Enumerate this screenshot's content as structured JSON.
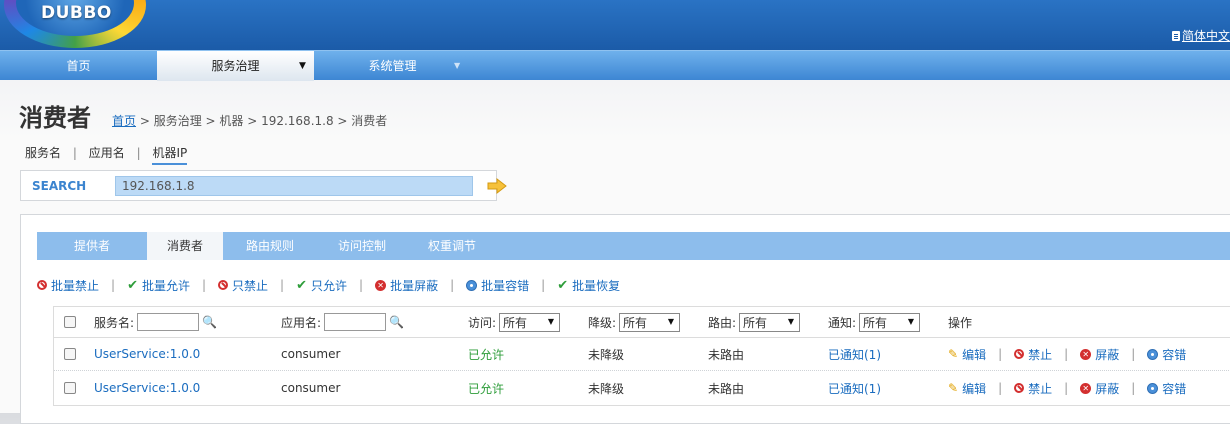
{
  "header": {
    "logo_text": "DUBBO",
    "language": "简体中文"
  },
  "nav": {
    "items": [
      {
        "label": "首页"
      },
      {
        "label": "服务治理"
      },
      {
        "label": "系统管理"
      }
    ]
  },
  "page": {
    "title": "消费者",
    "breadcrumb": {
      "home": "首页",
      "rest": " > 服务治理 > 机器 > 192.168.1.8 > 消费者"
    }
  },
  "filter_tabs": {
    "items": [
      "服务名",
      "应用名",
      "机器IP"
    ],
    "separator": "|",
    "active": "机器IP"
  },
  "search": {
    "label": "SEARCH",
    "value": "192.168.1.8"
  },
  "tabs": {
    "items": [
      "提供者",
      "消费者",
      "路由规则",
      "访问控制",
      "权重调节"
    ],
    "active": "消费者"
  },
  "toolbar": {
    "batch_disable": "批量禁止",
    "batch_allow": "批量允许",
    "only_disable": "只禁止",
    "only_allow": "只允许",
    "batch_shield": "批量屏蔽",
    "batch_tolerance": "批量容错",
    "batch_restore": "批量恢复",
    "separator": "|"
  },
  "table": {
    "headers": {
      "service": "服务名:",
      "app": "应用名:",
      "access": "访问:",
      "degrade": "降级:",
      "route": "路由:",
      "notify": "通知:",
      "ops": "操作"
    },
    "filter_option": "所有",
    "rows": [
      {
        "service": "UserService:1.0.0",
        "app": "consumer",
        "access": "已允许",
        "degrade": "未降级",
        "route": "未路由",
        "notify": "已通知(1)"
      },
      {
        "service": "UserService:1.0.0",
        "app": "consumer",
        "access": "已允许",
        "degrade": "未降级",
        "route": "未路由",
        "notify": "已通知(1)"
      }
    ],
    "ops": {
      "edit": "编辑",
      "disable": "禁止",
      "shield": "屏蔽",
      "tolerance": "容错",
      "separator": "|"
    }
  },
  "colors": {
    "link": "#1a6cbf",
    "allowed": "#2e9d3a",
    "danger": "#d32f2f",
    "tab_bar": "#8dbdec",
    "header": "#1b5ba8"
  }
}
